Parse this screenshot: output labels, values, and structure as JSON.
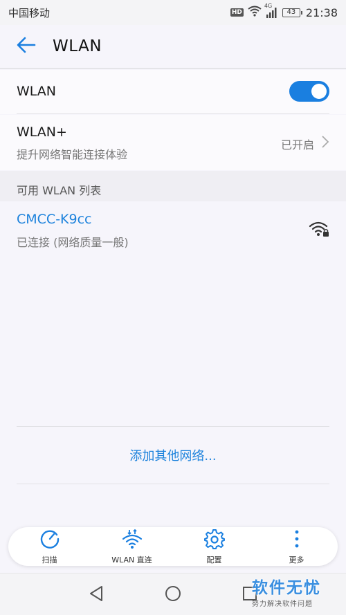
{
  "status_bar": {
    "carrier": "中国移动",
    "hd_badge": "HD",
    "network_type": "4G",
    "battery": "43",
    "time": "21:38"
  },
  "header": {
    "back_icon": "arrow-left-icon",
    "title": "WLAN"
  },
  "wlan_toggle": {
    "label": "WLAN",
    "state": "on",
    "accent": "#1a7fe0"
  },
  "wlan_plus": {
    "label": "WLAN+",
    "subtitle": "提升网络智能连接体验",
    "status": "已开启"
  },
  "available_list": {
    "header": "可用 WLAN 列表",
    "networks": [
      {
        "ssid": "CMCC-K9cc",
        "status": "已连接 (网络质量一般)",
        "icon": "wifi-lock-icon"
      }
    ]
  },
  "add_network": {
    "label": "添加其他网络..."
  },
  "toolbar": {
    "items": [
      {
        "label": "扫描",
        "icon": "scan-icon"
      },
      {
        "label": "WLAN 直连",
        "icon": "wifi-direct-icon"
      },
      {
        "label": "配置",
        "icon": "gear-icon"
      },
      {
        "label": "更多",
        "icon": "more-vertical-icon"
      }
    ]
  },
  "watermark": {
    "title": "软件无忧",
    "subtitle": "努力解决软件问题"
  },
  "colors": {
    "link": "#1c82dc",
    "background": "#f6f5fb"
  }
}
